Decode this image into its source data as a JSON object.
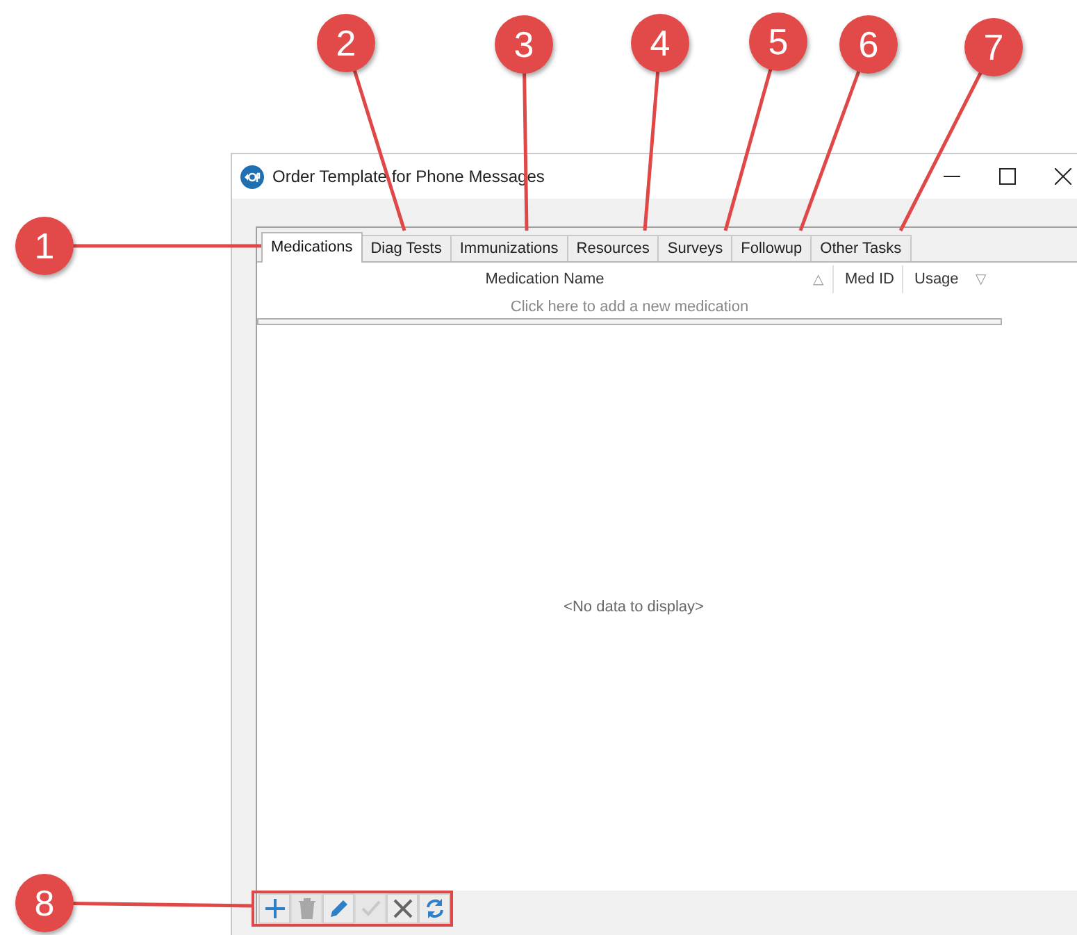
{
  "window": {
    "title": "Order Template for Phone Messages"
  },
  "tabs": [
    {
      "label": "Medications",
      "selected": true
    },
    {
      "label": "Diag Tests",
      "selected": false
    },
    {
      "label": "Immunizations",
      "selected": false
    },
    {
      "label": "Resources",
      "selected": false
    },
    {
      "label": "Surveys",
      "selected": false
    },
    {
      "label": "Followup",
      "selected": false
    },
    {
      "label": "Other Tasks",
      "selected": false
    }
  ],
  "grid": {
    "columns": [
      {
        "label": "Medication Name",
        "sort": "△"
      },
      {
        "label": "Med ID"
      },
      {
        "label": "Usage",
        "sort": "▽"
      }
    ],
    "new_row_prompt": "Click here to add a new medication",
    "empty_text": "<No data to display>"
  },
  "toolbar": [
    {
      "kind": "add",
      "disabled": false
    },
    {
      "kind": "delete",
      "disabled": true
    },
    {
      "kind": "edit",
      "disabled": false
    },
    {
      "kind": "save",
      "disabled": true
    },
    {
      "kind": "cancel",
      "disabled": false
    },
    {
      "kind": "refresh",
      "disabled": false
    }
  ],
  "callouts": [
    "1",
    "2",
    "3",
    "4",
    "5",
    "6",
    "7",
    "8"
  ]
}
